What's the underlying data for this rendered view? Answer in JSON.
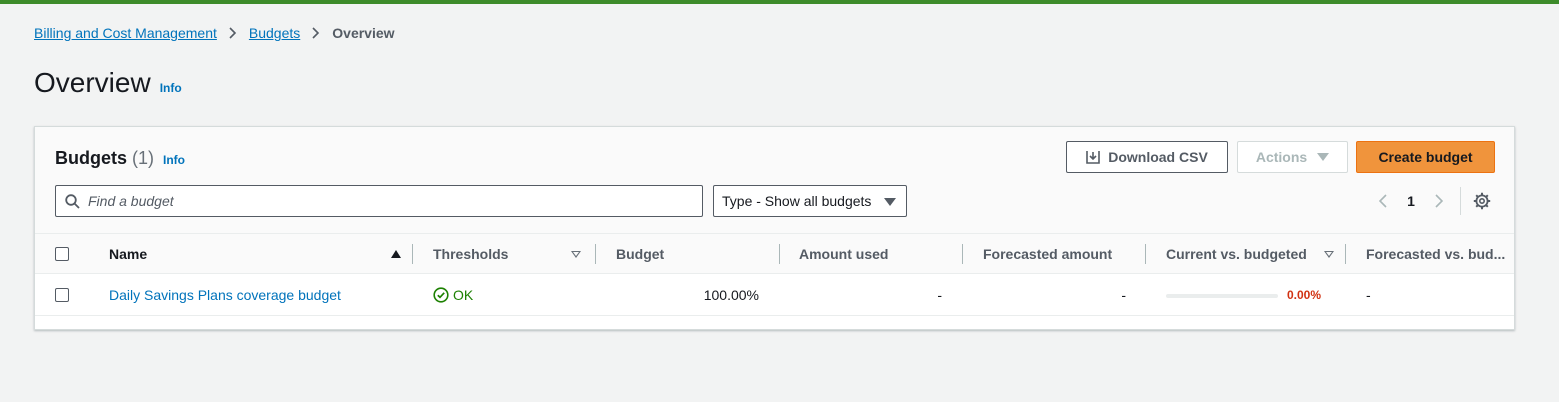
{
  "breadcrumb": {
    "items": [
      "Billing and Cost Management",
      "Budgets"
    ],
    "current": "Overview"
  },
  "page": {
    "title": "Overview",
    "info": "Info"
  },
  "budgets_panel": {
    "title": "Budgets",
    "count": "(1)",
    "info": "Info",
    "download_label": "Download CSV",
    "actions_label": "Actions",
    "create_label": "Create budget",
    "search_placeholder": "Find a budget",
    "type_filter": "Type - Show all budgets",
    "page_number": "1"
  },
  "table": {
    "columns": {
      "name": "Name",
      "thresholds": "Thresholds",
      "budget": "Budget",
      "amount_used": "Amount used",
      "forecasted_amount": "Forecasted amount",
      "current_vs_budgeted": "Current vs. budgeted",
      "forecasted_vs_budgeted": "Forecasted vs. bud..."
    },
    "rows": [
      {
        "name": "Daily Savings Plans coverage budget",
        "thresholds": "OK",
        "budget": "100.00%",
        "amount_used": "-",
        "forecasted_amount": "-",
        "current_vs_budgeted": "0.00%",
        "current_vs_budgeted_fraction": 0.0,
        "forecasted_vs_budgeted": "-"
      }
    ]
  },
  "colors": {
    "link": "#0073bb",
    "primary_button": "#f0943c",
    "ok": "#1d8102",
    "warning_text": "#d13212",
    "top_accent": "#3d8b2a"
  }
}
